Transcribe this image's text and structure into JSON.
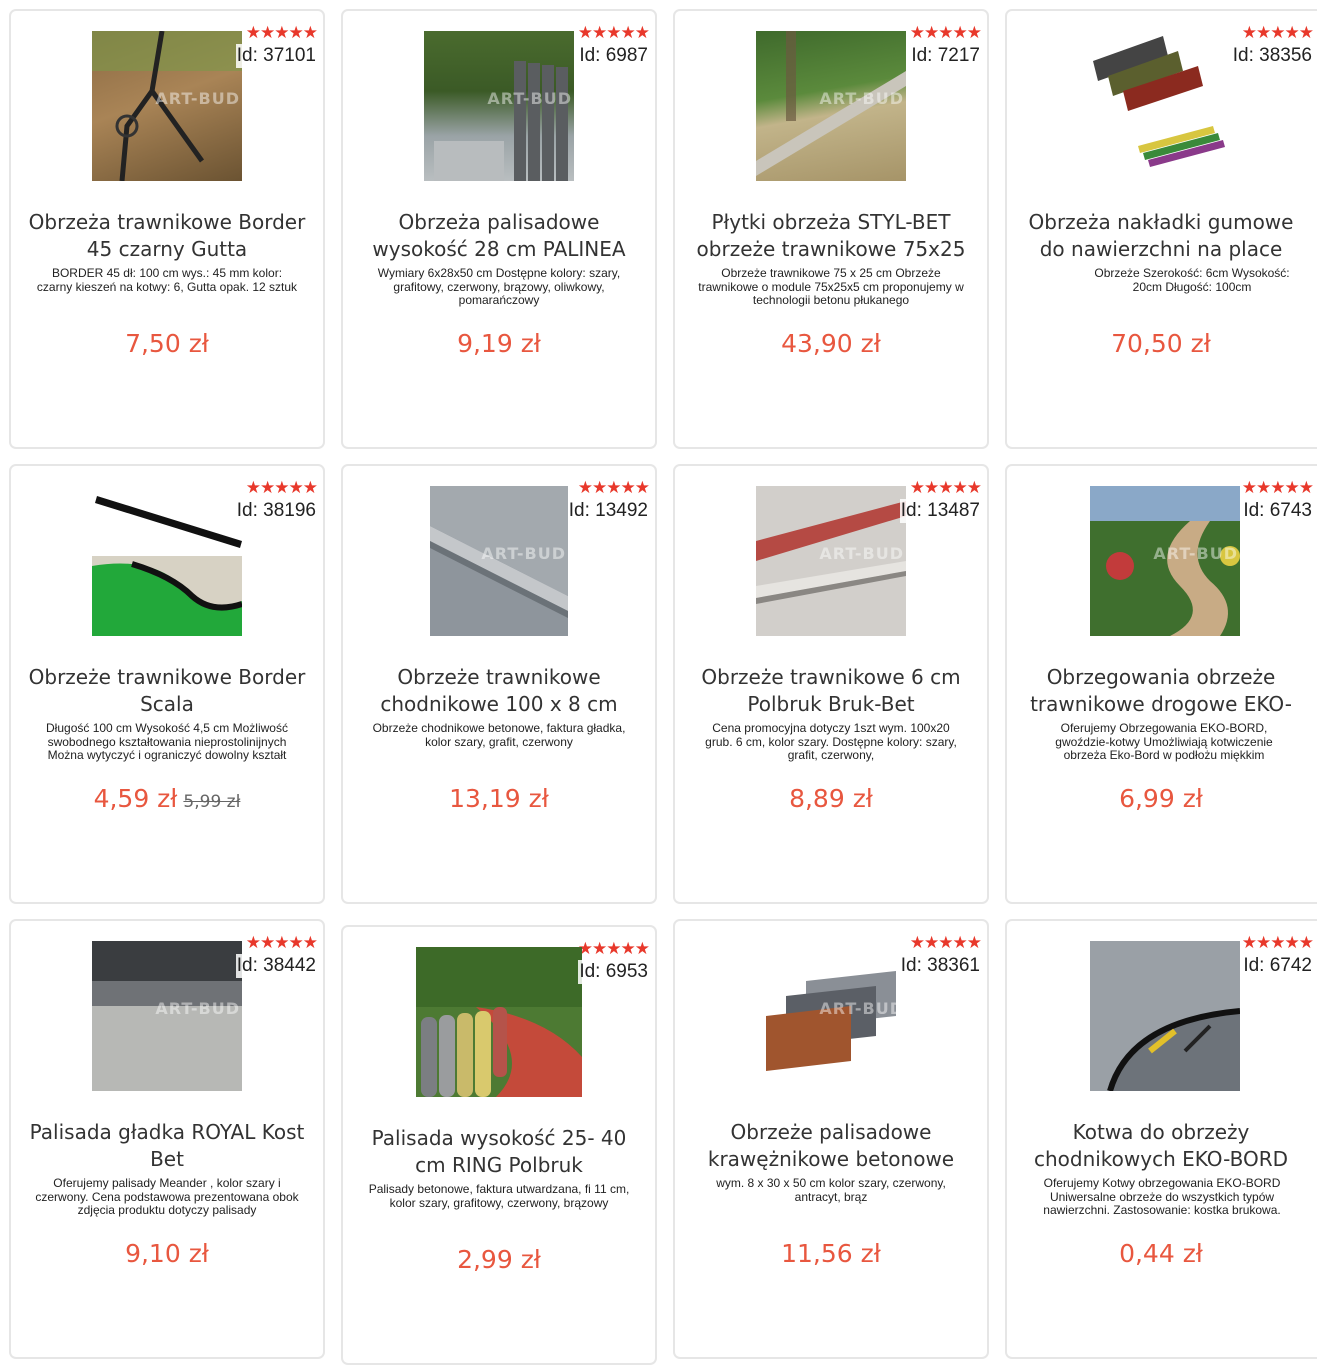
{
  "products": [
    {
      "id": "Id: 37101",
      "rating": "★★★★★",
      "title": "Obrzeża trawnikowe Border 45 czarny Gutta",
      "desc": "BORDER 45 dł: 100 cm wys.: 45 mm kolor: czarny kieszeń na kotwy: 6, Gutta opak. 12 sztuk",
      "price": "7,50 zł"
    },
    {
      "id": "Id: 6987",
      "rating": "★★★★★",
      "title": "Obrzeża palisadowe wysokość 28 cm PALINEA",
      "desc": "Wymiary 6x28x50 cm Dostępne kolory: szary, grafitowy, czerwony, brązowy, oliwkowy, pomarańczowy",
      "price": "9,19 zł"
    },
    {
      "id": "Id: 7217",
      "rating": "★★★★★",
      "title": "Płytki obrzeża STYL-BET obrzeże trawnikowe 75x25",
      "desc": "Obrzeże trawnikowe 75 x 25 cm Obrzeże trawnikowe o module 75x25x5 cm proponujemy w technologii betonu płukanego",
      "price": "43,90 zł"
    },
    {
      "id": "Id: 38356",
      "rating": "★★★★★",
      "title": "Obrzeża nakładki gumowe do nawierzchni na place",
      "desc": "Obrzeże Szerokość: 6cm Wysokość: 20cm Długość: 100cm",
      "price": "70,50 zł"
    },
    {
      "id": "Id: 38196",
      "rating": "★★★★★",
      "title": "Obrzeże trawnikowe Border Scala",
      "desc": "Długość 100 cm Wysokość 4,5 cm Możliwość swobodnego kształtowania nieprostolinijnych Można wytyczyć i ograniczyć dowolny kształt",
      "price": "4,59 zł",
      "old_price": "5,99 zł"
    },
    {
      "id": "Id: 13492",
      "rating": "★★★★★",
      "title": "Obrzeże trawnikowe chodnikowe 100 x 8 cm",
      "desc": "Obrzeże chodnikowe betonowe, faktura gładka, kolor szary, grafit, czerwony",
      "price": "13,19 zł"
    },
    {
      "id": "Id: 13487",
      "rating": "★★★★★",
      "title": "Obrzeże trawnikowe 6 cm Polbruk Bruk-Bet",
      "desc": "Cena promocyjna dotyczy 1szt wym. 100x20 grub. 6 cm, kolor szary. Dostępne kolory: szary, grafit, czerwony,",
      "price": "8,89 zł"
    },
    {
      "id": "Id: 6743",
      "rating": "★★★★★",
      "title": "Obrzegowania obrzeże trawnikowe drogowe EKO-",
      "desc": "Oferujemy Obrzegowania EKO-BORD, gwoździe-kotwy Umożliwiają kotwiczenie obrzeża Eko-Bord w podłożu miękkim",
      "price": "6,99 zł"
    },
    {
      "id": "Id: 38442",
      "rating": "★★★★★",
      "title": "Palisada gładka ROYAL Kost Bet",
      "desc": "Oferujemy palisady Meander , kolor szary i czerwony. Cena podstawowa prezentowana obok zdjęcia produktu dotyczy palisady",
      "price": "9,10 zł"
    },
    {
      "id": "Id: 6953",
      "rating": "★★★★★",
      "title": "Palisada wysokość 25- 40 cm RING Polbruk",
      "desc": "Palisady betonowe, faktura utwardzana, fi 11 cm, kolor szary, grafitowy, czerwony, brązowy",
      "price": "2,99 zł"
    },
    {
      "id": "Id: 38361",
      "rating": "★★★★★",
      "title": "Obrzeże palisadowe krawężnikowe betonowe",
      "desc": "wym. 8 x 30 x 50 cm kolor szary, czerwony, antracyt, brąz",
      "price": "11,56 zł"
    },
    {
      "id": "Id: 6742",
      "rating": "★★★★★",
      "title": "Kotwa do obrzeży chodnikowych EKO-BORD",
      "desc": "Oferujemy Kotwy obrzegowania EKO-BORD Uniwersalne obrzeże do wszystkich typów nawierzchni. Zastosowanie: kostka brukowa.",
      "price": "0,44 zł"
    }
  ],
  "watermark": "ART-BUD",
  "colors": {
    "price": "#e8573f",
    "stars": "#e8382b",
    "border": "#e6e6e6"
  }
}
